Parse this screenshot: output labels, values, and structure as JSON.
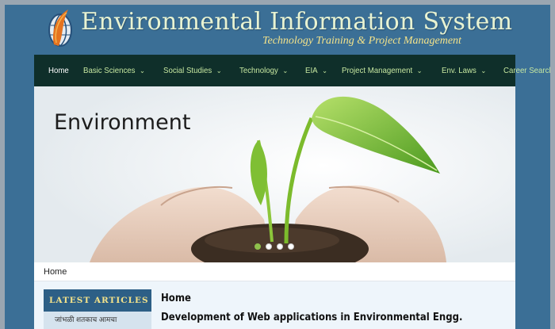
{
  "site": {
    "title": "Environmental Information System",
    "tagline": "Technology Training & Project Management"
  },
  "nav": {
    "items": [
      {
        "label": "Home",
        "dropdown": false
      },
      {
        "label": "Basic Sciences",
        "dropdown": true
      },
      {
        "label": "Social Studies",
        "dropdown": true
      },
      {
        "label": "Technology",
        "dropdown": true
      },
      {
        "label": "EIA",
        "dropdown": true
      },
      {
        "label": "Project Management",
        "dropdown": true
      },
      {
        "label": "Env. Laws",
        "dropdown": true
      },
      {
        "label": "Career Search",
        "dropdown": false
      }
    ]
  },
  "banner": {
    "title": "Environment",
    "slides": 4,
    "active_slide": 1
  },
  "breadcrumb": {
    "current": "Home"
  },
  "sidebar": {
    "heading": "LATEST ARTICLES",
    "first_item": "जांभळी शतकाच आमचा"
  },
  "main": {
    "title": "Home",
    "subtitle": "Development of Web applications in Environmental Engg."
  },
  "colors": {
    "frame": "#3b6f96",
    "nav_bg": "#0f2f2a",
    "nav_text": "#c6e7a0",
    "title_text": "#e8f3d2",
    "tagline_text": "#f3e28a",
    "sidebar_head": "#2d5f86",
    "slide_dot_active": "#8fc04c"
  },
  "icons": {
    "logo": "globe-leaf-logo-icon",
    "dropdown": "chevron-down-icon"
  }
}
